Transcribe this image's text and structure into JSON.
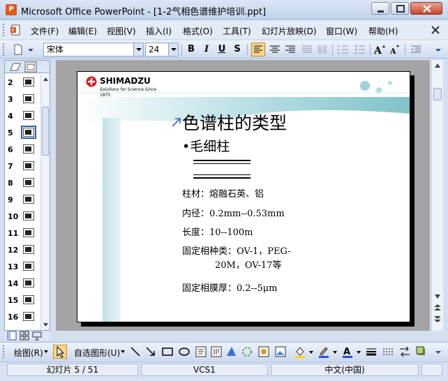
{
  "window": {
    "title": "Microsoft Office PowerPoint - [1-2气相色谱维护培训.ppt]",
    "app_icon_letter": "P"
  },
  "menu": {
    "items": [
      {
        "label": "文件(F)"
      },
      {
        "label": "编辑(E)"
      },
      {
        "label": "视图(V)"
      },
      {
        "label": "插入(I)"
      },
      {
        "label": "格式(O)"
      },
      {
        "label": "工具(T)"
      },
      {
        "label": "幻灯片放映(D)"
      },
      {
        "label": "窗口(W)"
      },
      {
        "label": "帮助(H)"
      }
    ]
  },
  "toolbar": {
    "font_name": "宋体",
    "font_size": "24",
    "bold_label": "B",
    "italic_label": "I",
    "underline_label": "U",
    "shadow_label": "S"
  },
  "thumbnails": {
    "numbers": [
      "2",
      "3",
      "4",
      "5",
      "6",
      "7",
      "8",
      "9",
      "10",
      "11",
      "12",
      "13",
      "14",
      "15",
      "16"
    ],
    "selected": "5"
  },
  "slide": {
    "logo_text": "SHIMADZU",
    "logo_tagline": "Solutions for Science Since",
    "logo_year": "1875",
    "title": "色谱柱的类型",
    "bullet": "•毛细柱",
    "lines": [
      "柱材：熔融石英、铝",
      "内径：0.2mm--0.53mm",
      "长度：10--100m",
      "固定相种类：OV-1，PEG-",
      "20M，OV-17等",
      "固定相膜厚：0.2--5μm"
    ]
  },
  "drawbar": {
    "draw_label": "绘图(R)",
    "autoshape_label": "自选图形(U)"
  },
  "status": {
    "slide_position": "幻灯片 5 / 51",
    "design": "VCS1",
    "language": "中文(中国)"
  },
  "colors": {
    "accent_teal": "#8cc8cf",
    "selection": "#2f5fb3",
    "logo_red": "#d61e1e"
  }
}
